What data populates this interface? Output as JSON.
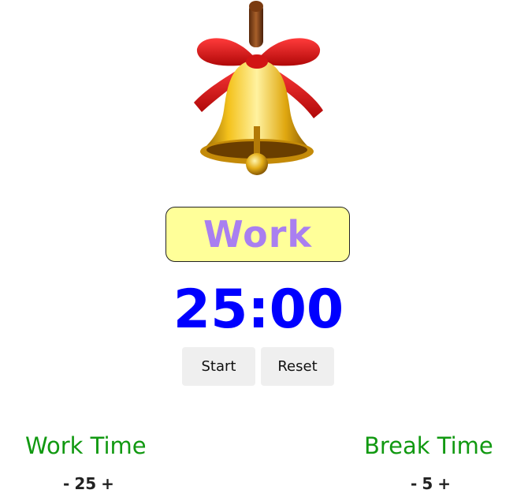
{
  "mode": {
    "label": "Work"
  },
  "timer": {
    "display": "25:00"
  },
  "controls": {
    "start_label": "Start",
    "reset_label": "Reset"
  },
  "settings": {
    "work": {
      "title": "Work Time",
      "minus": "-",
      "value": "25",
      "plus": "+"
    },
    "break": {
      "title": "Break Time",
      "minus": "-",
      "value": "5",
      "plus": "+"
    }
  },
  "colors": {
    "mode_bg": "#ffff99",
    "mode_text": "#a97ff0",
    "timer_text": "#0000ff",
    "setting_title": "#119911"
  },
  "icons": {
    "bell": "bell-icon"
  }
}
